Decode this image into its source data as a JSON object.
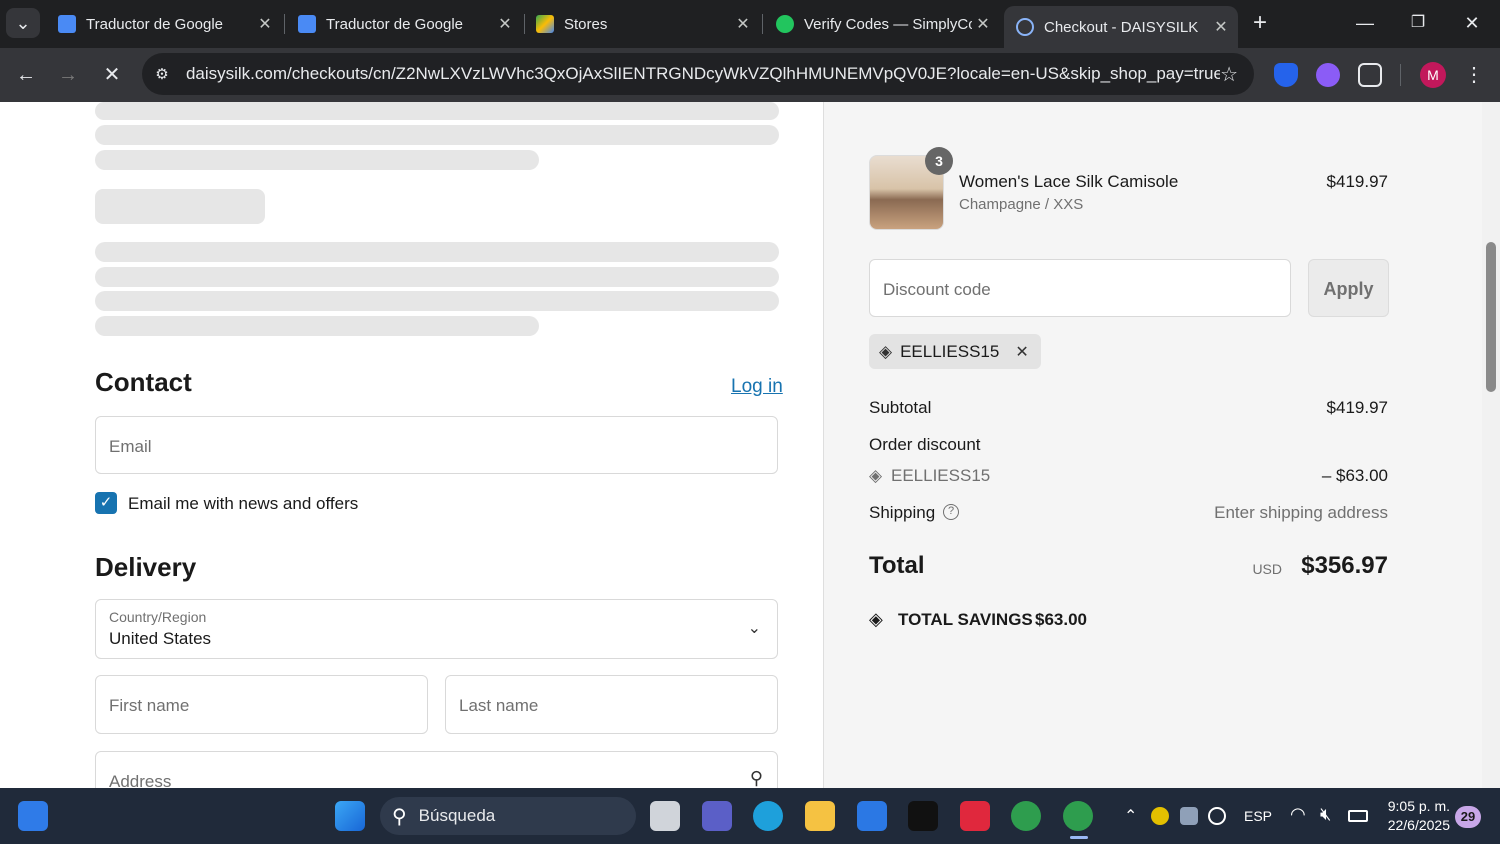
{
  "tabs": [
    {
      "title": "Traductor de Google",
      "icon": "google-translate-icon"
    },
    {
      "title": "Traductor de Google",
      "icon": "google-translate-icon"
    },
    {
      "title": "Stores",
      "icon": "stores-icon"
    },
    {
      "title": "Verify Codes — SimplyCo",
      "icon": "verify-codes-icon"
    },
    {
      "title": "Checkout - DAISYSILK",
      "icon": "loading-icon",
      "active": true
    }
  ],
  "toolbar": {
    "url": "daisysilk.com/checkouts/cn/Z2NwLXVzLWVhc3QxOjAxSlIENTRGNDcyWkVZQlhHMUNEMVpQV0JE?locale=en-US&skip_shop_pay=true",
    "profile_initial": "M"
  },
  "contact": {
    "heading": "Contact",
    "login_link": "Log in",
    "email_placeholder": "Email",
    "newsletter_label": "Email me with news and offers",
    "newsletter_checked": true
  },
  "delivery": {
    "heading": "Delivery",
    "country_label": "Country/Region",
    "country_value": "United States",
    "first_name_placeholder": "First name",
    "last_name_placeholder": "Last name",
    "address_placeholder": "Address"
  },
  "summary": {
    "item": {
      "name": "Women's Lace Silk Camisole",
      "variant": "Champagne / XXS",
      "price": "$419.97",
      "quantity": "3"
    },
    "discount_placeholder": "Discount code",
    "apply_label": "Apply",
    "applied_code": "EELLIESS15",
    "subtotal_label": "Subtotal",
    "subtotal_value": "$419.97",
    "order_discount_label": "Order discount",
    "discount_code_line": "EELLIESS15",
    "discount_value": "– $63.00",
    "shipping_label": "Shipping",
    "shipping_value": "Enter shipping address",
    "total_label": "Total",
    "currency": "USD",
    "total_value": "$356.97",
    "savings_label": "TOTAL SAVINGS",
    "savings_value": "$63.00"
  },
  "taskbar": {
    "search_label": "Búsqueda",
    "language": "ESP",
    "time": "9:05 p. m.",
    "date": "22/6/2025",
    "notification_count": "29"
  },
  "colors": {
    "accent_blue": "#1773b0",
    "tab_bar": "#1f2022",
    "toolbar": "#35363a",
    "taskbar": "#202a3a"
  }
}
